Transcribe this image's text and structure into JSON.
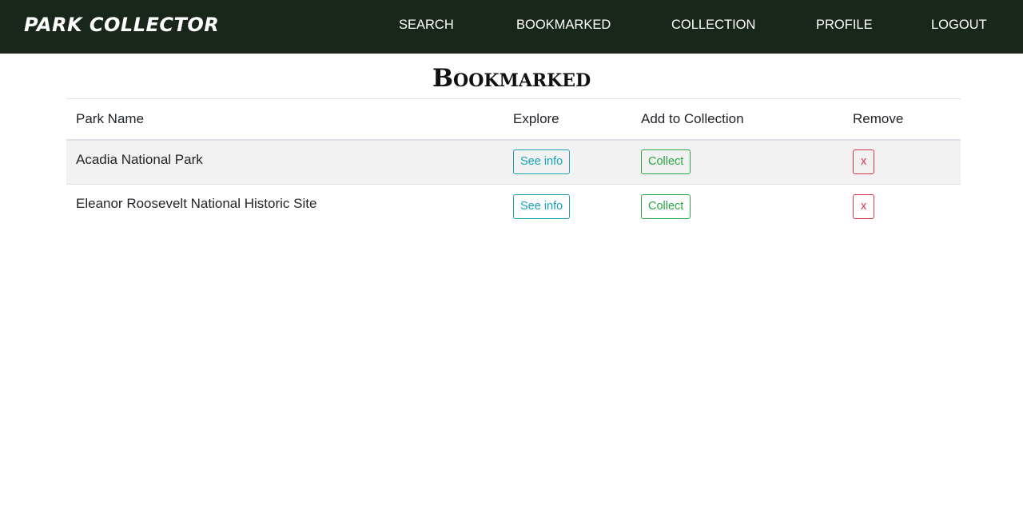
{
  "navbar": {
    "brand": "PARK COLLECTOR",
    "links": [
      "SEARCH",
      "BOOKMARKED",
      "COLLECTION",
      "PROFILE",
      "LOGOUT"
    ]
  },
  "page": {
    "title": "Bookmarked"
  },
  "table": {
    "headers": [
      "Park Name",
      "Explore",
      "Add to Collection",
      "Remove"
    ],
    "rows": [
      {
        "park_name": "Acadia National Park",
        "explore_label": "See info",
        "collect_label": "Collect",
        "remove_label": "x"
      },
      {
        "park_name": "Eleanor Roosevelt National Historic Site",
        "explore_label": "See info",
        "collect_label": "Collect",
        "remove_label": "x"
      }
    ]
  },
  "colors": {
    "navbar_bg": "#18271a",
    "info": "#17a2b8",
    "success": "#28a745",
    "danger": "#dc3545",
    "stripe": "#f2f2f2"
  }
}
